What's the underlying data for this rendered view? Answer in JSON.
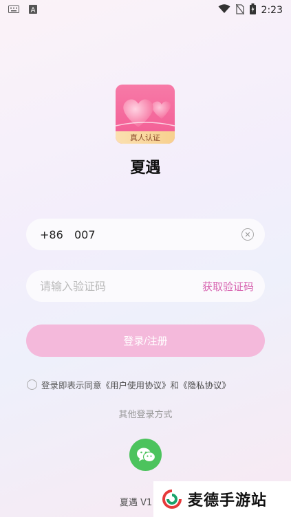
{
  "status_bar": {
    "time": "2:23",
    "icons": [
      "keyboard-icon",
      "a-icon",
      "wifi-icon",
      "no-sim-icon",
      "battery-charging-icon"
    ]
  },
  "app": {
    "logo_badge": "真人认证",
    "title": "夏遇"
  },
  "form": {
    "phone_prefix": "+86",
    "phone_value": "007",
    "code_placeholder": "请输入验证码",
    "get_code_label": "获取验证码",
    "login_label": "登录/注册"
  },
  "agreement": {
    "prefix": "登录即表示同意",
    "user_agreement": "《用户使用协议》",
    "and": "和",
    "privacy": "《隐私协议》"
  },
  "other_login": {
    "label": "其他登录方式",
    "method": "wechat-icon"
  },
  "footer": {
    "version": "夏遇 V1"
  },
  "watermark": {
    "text": "麦德手游站"
  },
  "colors": {
    "accent_pink": "#d764b0",
    "login_button": "#f4b9db",
    "wechat_green": "#4cc35d"
  }
}
